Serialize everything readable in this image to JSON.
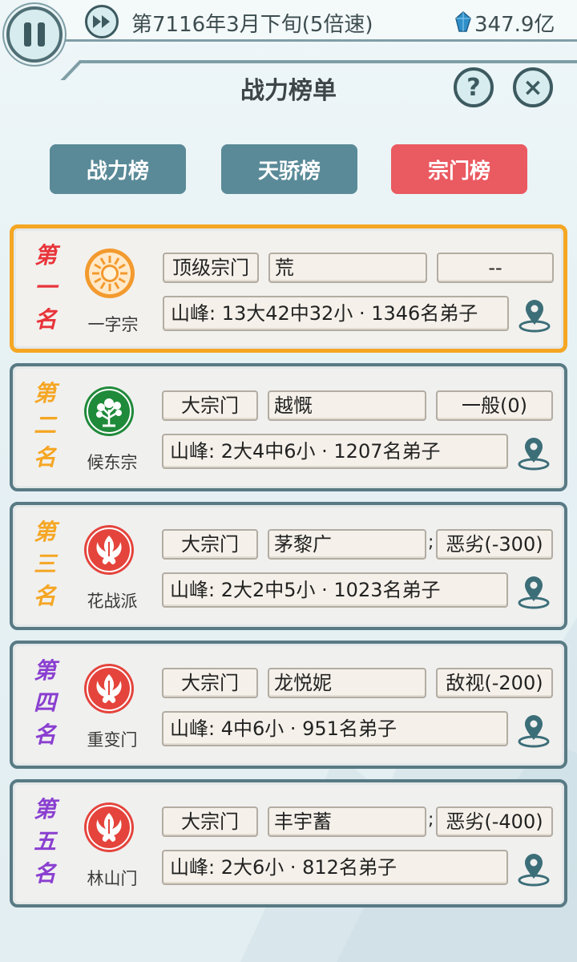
{
  "status_bar": {
    "date": "第7116年3月下旬(5倍速)",
    "currency": "347.9亿"
  },
  "header": {
    "title": "战力榜单",
    "help_label": "?",
    "close_label": "×"
  },
  "tabs": [
    {
      "label": "战力榜",
      "active": false
    },
    {
      "label": "天骄榜",
      "active": false
    },
    {
      "label": "宗门榜",
      "active": true
    }
  ],
  "colors": {
    "accent_teal": "#5a8a98",
    "active_tab": "#ea5a61",
    "first_border": "#f5a623",
    "rank1": "#e8343a",
    "rank2_3": "#f5a623",
    "rank4_5": "#8a3fd0"
  },
  "rankings": [
    {
      "rank_chars": [
        "第",
        "一",
        "名"
      ],
      "rank_color": "#e8343a",
      "emblem": "sun-emblem-icon",
      "sect_name": "一字宗",
      "level": "顶级宗门",
      "leader": "荒",
      "relation": "--",
      "show_semicolon": false,
      "stats": "山峰: 13大42中32小 · 1346名弟子"
    },
    {
      "rank_chars": [
        "第",
        "二",
        "名"
      ],
      "rank_color": "#f5a623",
      "emblem": "tree-emblem-icon",
      "sect_name": "候东宗",
      "level": "大宗门",
      "leader": "越慨",
      "relation": "一般(0)",
      "show_semicolon": false,
      "stats": "山峰: 2大4中6小 · 1207名弟子"
    },
    {
      "rank_chars": [
        "第",
        "三",
        "名"
      ],
      "rank_color": "#f5a623",
      "emblem": "phoenix-emblem-icon",
      "sect_name": "花战派",
      "level": "大宗门",
      "leader": "茅黎广",
      "relation": "恶劣(-300)",
      "show_semicolon": true,
      "stats": "山峰: 2大2中5小 · 1023名弟子"
    },
    {
      "rank_chars": [
        "第",
        "四",
        "名"
      ],
      "rank_color": "#8a3fd0",
      "emblem": "phoenix-emblem-icon",
      "sect_name": "重变门",
      "level": "大宗门",
      "leader": "龙悦妮",
      "relation": "敌视(-200)",
      "show_semicolon": false,
      "stats": "山峰: 4中6小 · 951名弟子"
    },
    {
      "rank_chars": [
        "第",
        "五",
        "名"
      ],
      "rank_color": "#8a3fd0",
      "emblem": "phoenix-emblem-icon",
      "sect_name": "林山门",
      "level": "大宗门",
      "leader": "丰宇蓄",
      "relation": "恶劣(-400)",
      "show_semicolon": true,
      "stats": "山峰: 2大6小 · 812名弟子"
    }
  ]
}
